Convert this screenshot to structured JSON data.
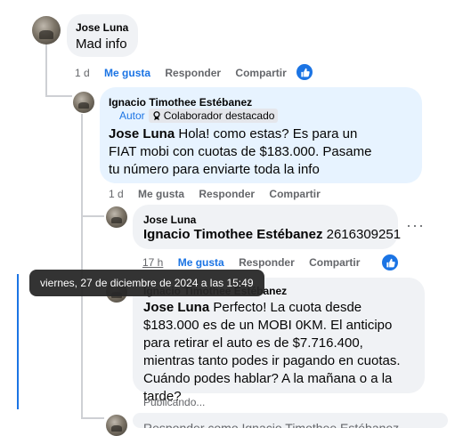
{
  "comment1": {
    "name": "Jose Luna",
    "text": "Mad info",
    "time": "1 d",
    "like": "Me gusta",
    "reply": "Responder",
    "share": "Compartir"
  },
  "comment2": {
    "name": "Ignacio Timothee Estébanez",
    "author_badge": "Autor",
    "collab_badge": "Colaborador destacado",
    "mention": "Jose Luna",
    "text": " Hola! como estas? Es para un FIAT mobi con cuotas de $183.000. Pasame tu número para enviarte toda la info",
    "time": "1 d",
    "like": "Me gusta",
    "reply": "Responder",
    "share": "Compartir"
  },
  "comment3": {
    "name": "Jose Luna",
    "mention": "Ignacio Timothee Estébanez",
    "text": " 2616309251",
    "time": "17 h",
    "like": "Me gusta",
    "reply": "Responder",
    "share": "Compartir",
    "more": "···"
  },
  "comment4": {
    "name": "Ignacio Timothee Estébanez",
    "mention": "Jose Luna",
    "text": " Perfecto! La cuota desde $183.000 es de un MOBI 0KM. El anticipo para retirar el auto es de $7.716.400, mientras tanto podes ir pagando en cuotas. Cuándo podes hablar? A la mañana o a la tarde?",
    "status": "Publicando..."
  },
  "tooltip": "viernes, 27 de diciembre de 2024 a las 15:49",
  "reply_input": {
    "placeholder": "Responder como Ignacio Timothee Estébanez"
  },
  "colors": {
    "accent": "#1b74e4",
    "bubble": "#f0f2f5",
    "highlight_bubble": "#e7f3ff",
    "meta": "#65676b"
  }
}
